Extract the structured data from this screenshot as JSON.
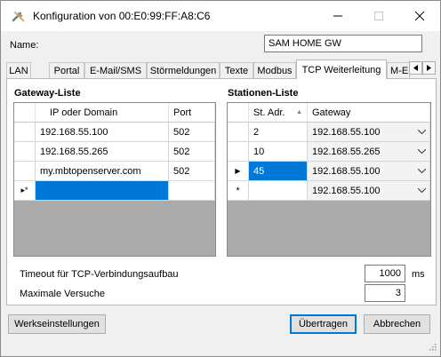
{
  "window": {
    "title": "Konfiguration von 00:E0:99:FF:A8:C6",
    "minimize_glyph": "—",
    "maximize_glyph": "☐",
    "close_glyph": "✕"
  },
  "name_row": {
    "label": "Name:",
    "value": "SAM HOME GW"
  },
  "tabs": [
    {
      "label": "LAN"
    },
    {
      "label": "Portal"
    },
    {
      "label": "E-Mail/SMS"
    },
    {
      "label": "Störmeldungen"
    },
    {
      "label": "Texte"
    },
    {
      "label": "Modbus"
    },
    {
      "label": "TCP Weiterleitung"
    },
    {
      "label": "M-E"
    }
  ],
  "active_tab": "TCP Weiterleitung",
  "gateway_list": {
    "title": "Gateway-Liste",
    "columns": [
      "IP oder Domain",
      "Port"
    ],
    "rows": [
      {
        "host": "192.168.55.100",
        "port": "502"
      },
      {
        "host": "192.168.55.265",
        "port": "502"
      },
      {
        "host": "my.mbtopenserver.com",
        "port": "502"
      }
    ],
    "new_row_marker": "▸*"
  },
  "station_list": {
    "title": "Stationen-Liste",
    "columns": [
      "St. Adr.",
      "Gateway"
    ],
    "sort_glyph": "▲",
    "rows": [
      {
        "addr": "2",
        "gateway": "192.168.55.100",
        "marker": ""
      },
      {
        "addr": "10",
        "gateway": "192.168.55.265",
        "marker": ""
      },
      {
        "addr": "45",
        "gateway": "192.168.55.100",
        "marker": "▶"
      }
    ],
    "new_row": {
      "marker": "*",
      "gateway": "192.168.55.100"
    }
  },
  "settings": {
    "timeout_label": "Timeout für TCP-Verbindungsaufbau",
    "timeout_value": "1000",
    "timeout_unit": "ms",
    "retries_label": "Maximale Versuche",
    "retries_value": "3"
  },
  "buttons": {
    "defaults": "Werkseinstellungen",
    "apply": "Übertragen",
    "cancel": "Abbrechen"
  },
  "colors": {
    "selection": "#0078d7",
    "grid_background": "#ababab"
  }
}
